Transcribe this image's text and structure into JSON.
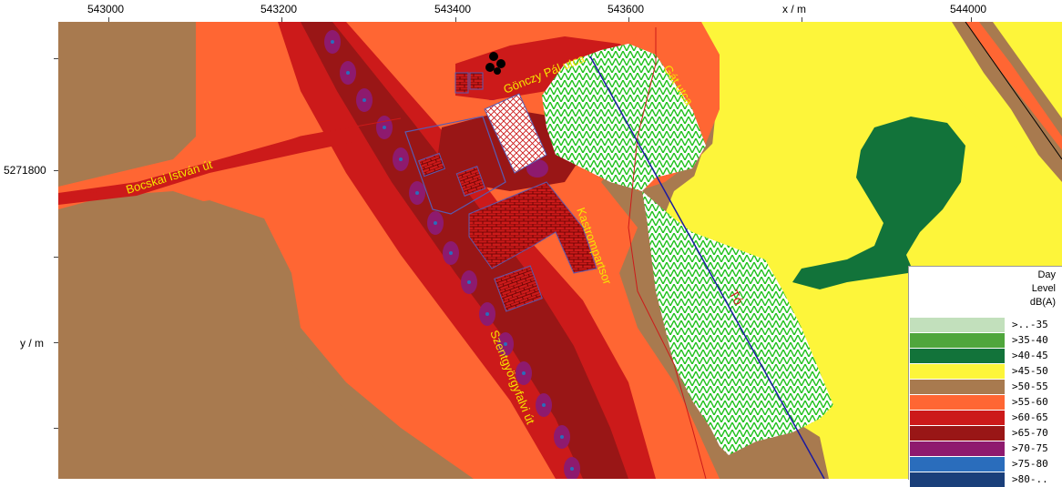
{
  "axes": {
    "x_title": "x / m",
    "y_title": "y / m",
    "x_ticks": [
      {
        "label": "543000"
      },
      {
        "label": "543200"
      },
      {
        "label": "543400"
      },
      {
        "label": "543600"
      },
      {
        "label": "544000"
      }
    ],
    "y_ticks": [
      {
        "label": "5271800"
      }
    ]
  },
  "streets": {
    "bocskai": "Bocskai István út",
    "gonczy": "Gönczy Pál utca",
    "gat": "Gát utca",
    "kastromparttsor": "Kastrompartsor",
    "szentgyorgyfalvi": "Szentgyörgyfalvi út",
    "to": "Tó"
  },
  "legend": {
    "title_lines": [
      "Day",
      "Level",
      "dB(A)"
    ],
    "items": [
      {
        "label": ">..-35",
        "color": "#c2e0bc"
      },
      {
        "label": ">35-40",
        "color": "#4fa63c"
      },
      {
        "label": ">40-45",
        "color": "#12733a"
      },
      {
        "label": ">45-50",
        "color": "#fdf53a"
      },
      {
        "label": ">50-55",
        "color": "#a87a4f"
      },
      {
        "label": ">55-60",
        "color": "#ff6633"
      },
      {
        "label": ">60-65",
        "color": "#cc1a1a"
      },
      {
        "label": ">65-70",
        "color": "#991616"
      },
      {
        "label": ">70-75",
        "color": "#8e1a6e"
      },
      {
        "label": ">75-80",
        "color": "#2a6dbc"
      },
      {
        "label": ">80-..",
        "color": "#1a3f7a"
      }
    ]
  }
}
